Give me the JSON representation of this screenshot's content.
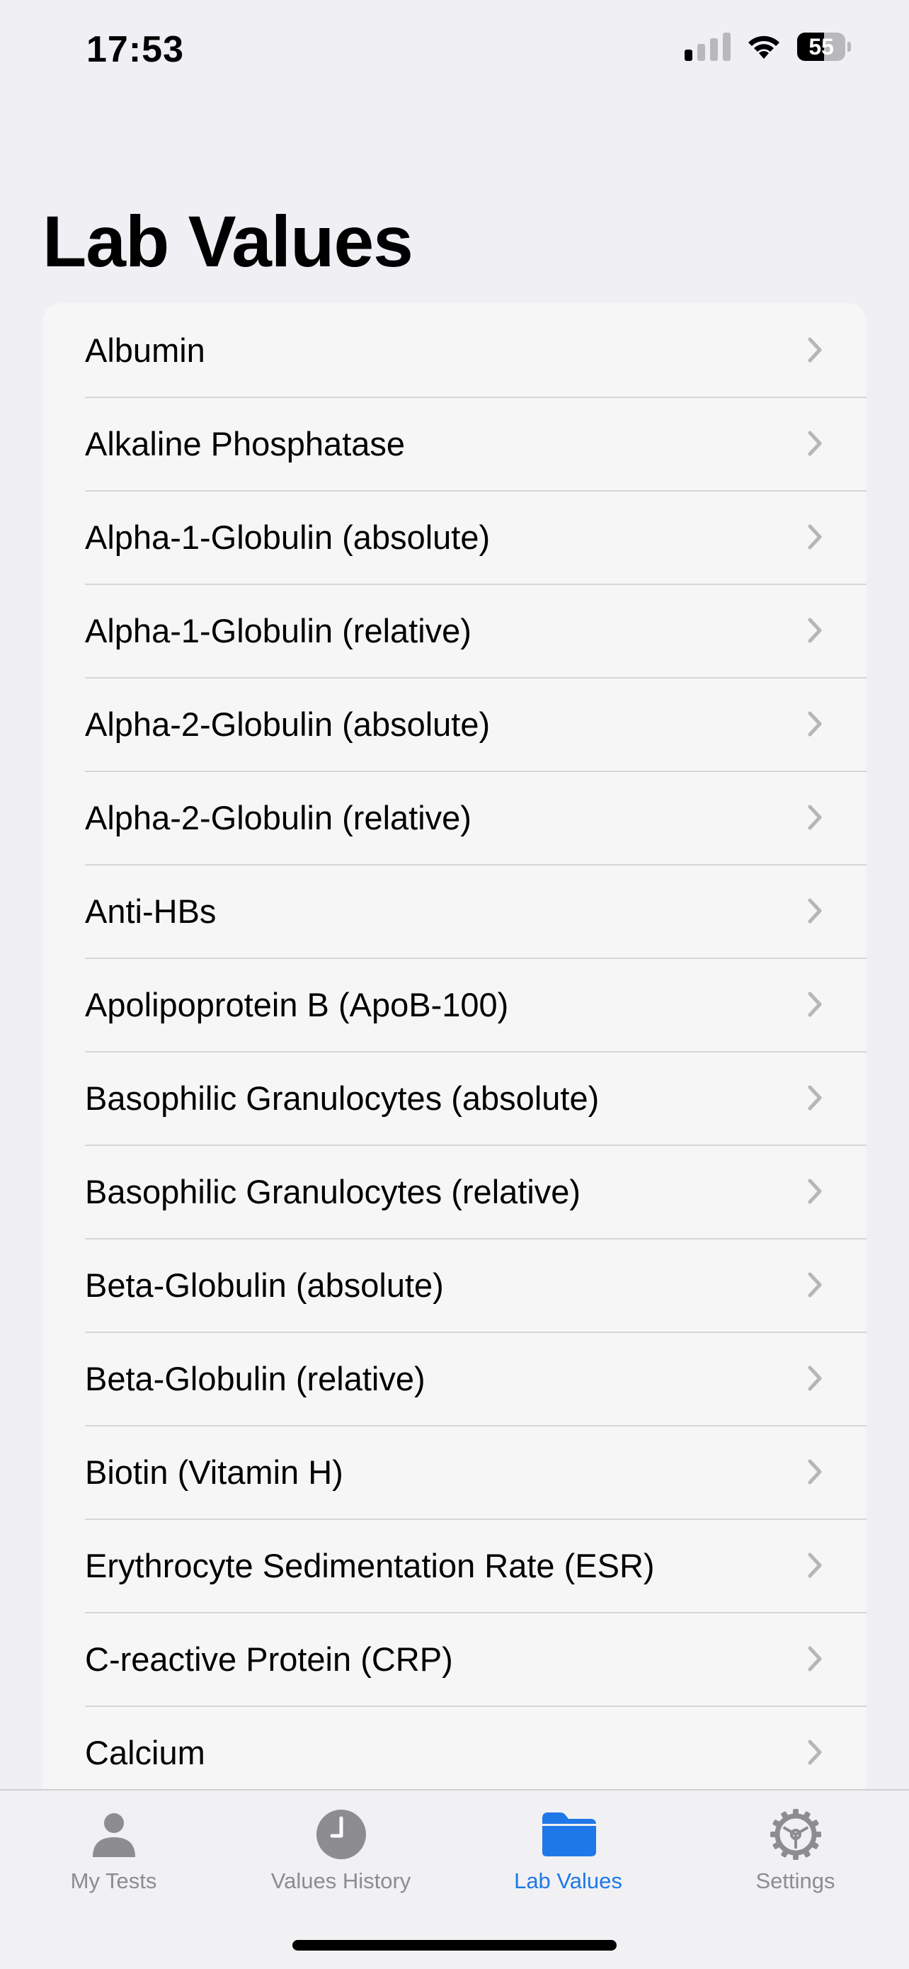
{
  "status_bar": {
    "time": "17:53",
    "battery_text": "55",
    "battery_level": 0.55,
    "signal_bars_on": 1,
    "signal_bars_total": 4
  },
  "page": {
    "title": "Lab Values"
  },
  "list": {
    "items": [
      {
        "label": "Albumin"
      },
      {
        "label": "Alkaline Phosphatase"
      },
      {
        "label": "Alpha-1-Globulin (absolute)"
      },
      {
        "label": "Alpha-1-Globulin (relative)"
      },
      {
        "label": "Alpha-2-Globulin (absolute)"
      },
      {
        "label": "Alpha-2-Globulin (relative)"
      },
      {
        "label": "Anti-HBs"
      },
      {
        "label": "Apolipoprotein B (ApoB-100)"
      },
      {
        "label": "Basophilic Granulocytes (absolute)"
      },
      {
        "label": "Basophilic Granulocytes (relative)"
      },
      {
        "label": "Beta-Globulin (absolute)"
      },
      {
        "label": "Beta-Globulin (relative)"
      },
      {
        "label": "Biotin (Vitamin H)"
      },
      {
        "label": "Erythrocyte Sedimentation Rate (ESR)"
      },
      {
        "label": "C-reactive Protein (CRP)"
      },
      {
        "label": "Calcium"
      },
      {
        "label": ""
      }
    ]
  },
  "tab_bar": {
    "tabs": [
      {
        "label": "My Tests",
        "icon": "person-icon",
        "active": false
      },
      {
        "label": "Values History",
        "icon": "clock-icon",
        "active": false
      },
      {
        "label": "Lab Values",
        "icon": "folder-icon",
        "active": true
      },
      {
        "label": "Settings",
        "icon": "gear-icon",
        "active": false
      }
    ]
  },
  "colors": {
    "accent": "#1f78e8",
    "inactive_tab": "#8c8c91",
    "background": "#efeff4",
    "card": "#f6f6f6",
    "chevron": "#b5b5ba"
  }
}
